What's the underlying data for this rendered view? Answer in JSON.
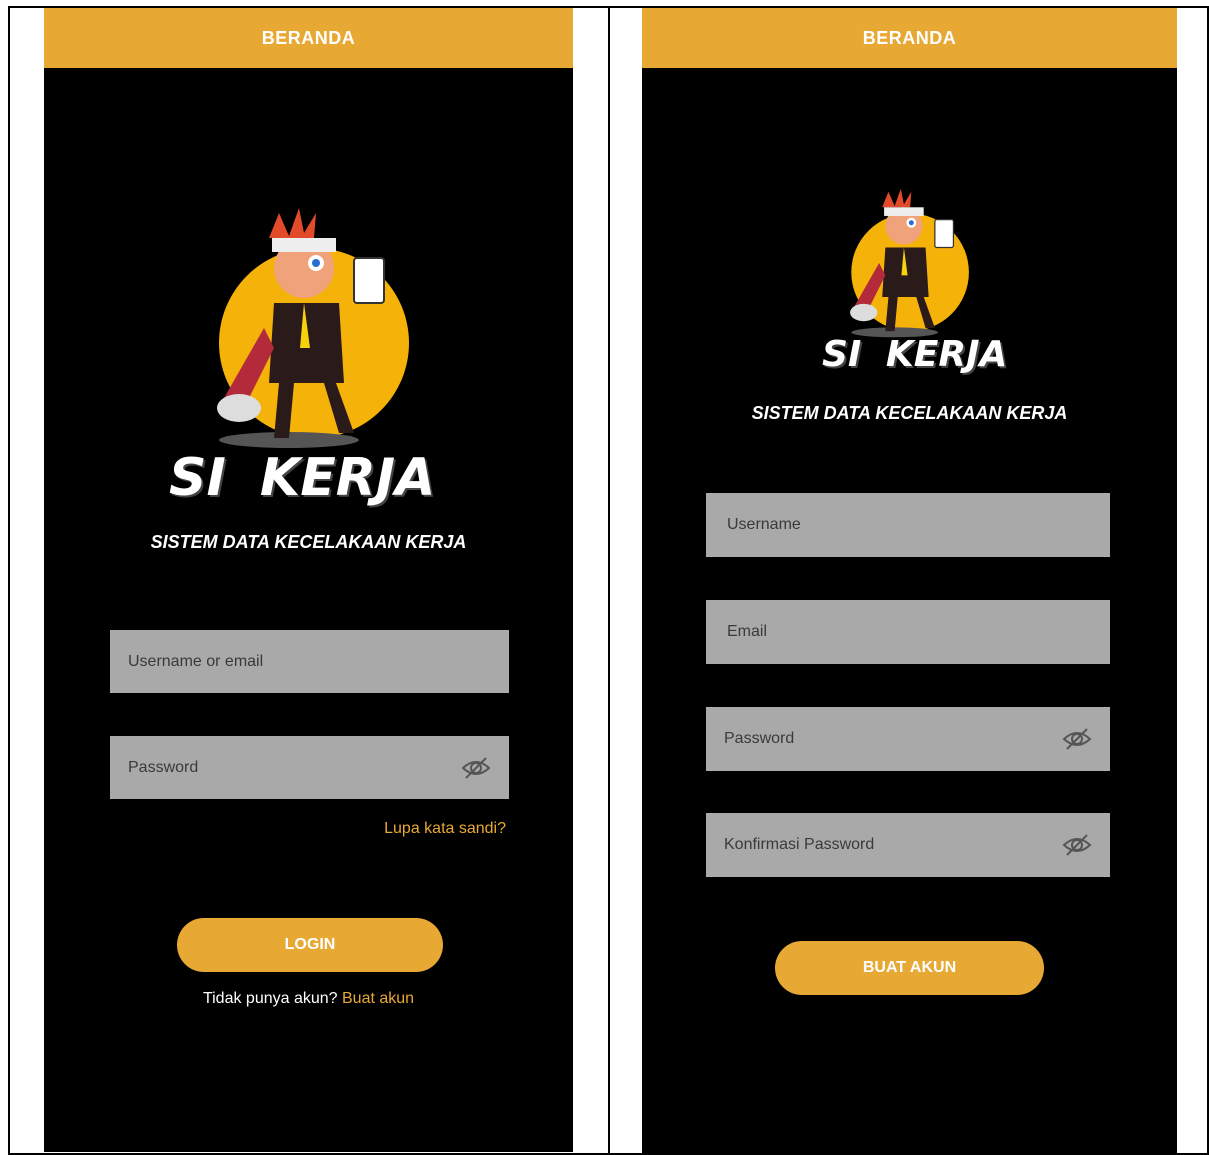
{
  "login": {
    "header": "BERANDA",
    "logo_text": "SI KERJA",
    "subtitle": "SISTEM DATA KECELAKAAN KERJA",
    "username_placeholder": "Username or email",
    "password_placeholder": "Password",
    "forgot": "Lupa kata sandi?",
    "button": "LOGIN",
    "no_account": "Tidak punya akun? ",
    "create_link": "Buat akun"
  },
  "register": {
    "header": "BERANDA",
    "logo_text": "SI KERJA",
    "subtitle": "SISTEM DATA KECELAKAAN KERJA",
    "username_placeholder": "Username",
    "email_placeholder": "Email",
    "password_placeholder": "Password",
    "confirm_placeholder": "Konfirmasi Password",
    "button": "BUAT AKUN"
  },
  "colors": {
    "accent": "#e8a834",
    "background": "#000000",
    "field": "#a9a9a9"
  },
  "icons": {
    "toggle_password": "eye-off-icon",
    "mascot": "mascot-logo"
  }
}
